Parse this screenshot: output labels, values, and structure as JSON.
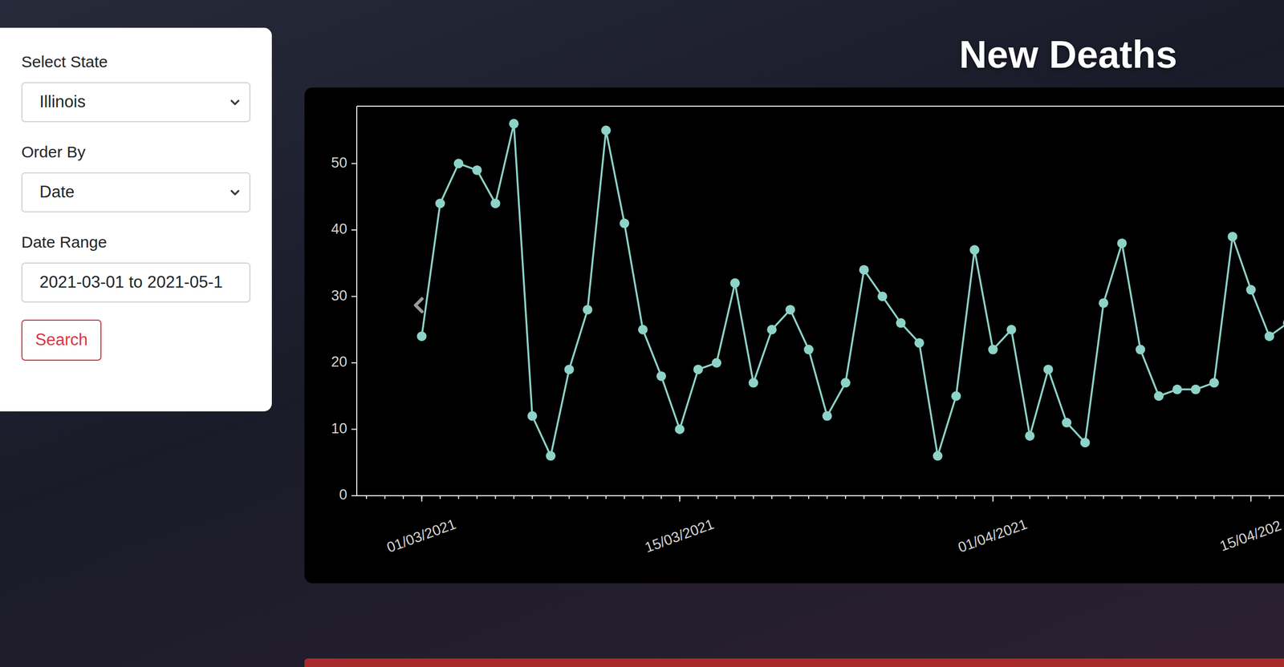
{
  "sidebar": {
    "fields": [
      {
        "label": "Select State",
        "value": "Illinois",
        "kind": "select"
      },
      {
        "label": "Order By",
        "value": "Date",
        "kind": "select"
      },
      {
        "label": "Date Range",
        "value": "2021-03-01 to 2021-05-1",
        "kind": "input"
      }
    ],
    "button": "Search"
  },
  "chart": {
    "title": "New Deaths",
    "y_ticks": [
      "0",
      "10",
      "20",
      "30",
      "40",
      "50"
    ],
    "x_ticks": [
      {
        "label": "01/03/2021",
        "day": 0
      },
      {
        "label": "15/03/2021",
        "day": 14
      },
      {
        "label": "01/04/2021",
        "day": 31
      },
      {
        "label": "15/04/202",
        "day": 45
      }
    ],
    "values": [
      24,
      44,
      50,
      49,
      44,
      56,
      12,
      6,
      19,
      28,
      55,
      41,
      25,
      18,
      10,
      19,
      20,
      32,
      17,
      25,
      28,
      22,
      12,
      17,
      34,
      30,
      26,
      23,
      6,
      15,
      37,
      22,
      25,
      9,
      19,
      11,
      8,
      29,
      38,
      22,
      15,
      16,
      16,
      17,
      39,
      31,
      24,
      26
    ]
  }
}
